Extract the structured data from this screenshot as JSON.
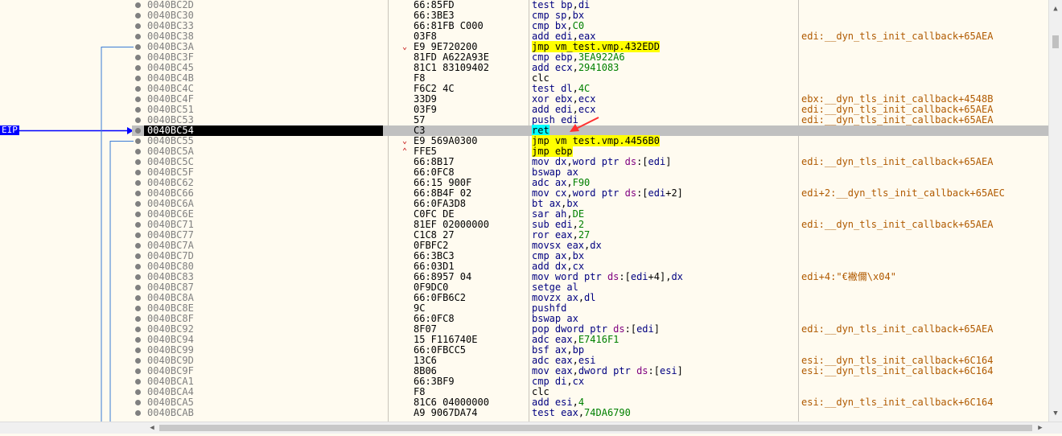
{
  "eip_label": "EIP",
  "rows": [
    {
      "addr": "0040BC2D",
      "bytes": "66:85FD",
      "dis": [
        [
          "test ",
          "kw-b"
        ],
        [
          "bp",
          "kw-b"
        ],
        [
          ",",
          ""
        ],
        [
          "di",
          "kw-b"
        ]
      ],
      "cmt": ""
    },
    {
      "addr": "0040BC30",
      "bytes": "66:3BE3",
      "dis": [
        [
          "cmp ",
          "kw-b"
        ],
        [
          "sp",
          "kw-b"
        ],
        [
          ",",
          ""
        ],
        [
          "bx",
          "kw-b"
        ]
      ],
      "cmt": ""
    },
    {
      "addr": "0040BC33",
      "bytes": "66:81FB C000",
      "dis": [
        [
          "cmp ",
          "kw-b"
        ],
        [
          "bx",
          "kw-b"
        ],
        [
          ",",
          ""
        ],
        [
          "C0",
          "num"
        ]
      ],
      "cmt": ""
    },
    {
      "addr": "0040BC38",
      "bytes": "03F8",
      "dis": [
        [
          "add ",
          "kw-b"
        ],
        [
          "edi",
          "kw-b"
        ],
        [
          ",",
          ""
        ],
        [
          "eax",
          "kw-b"
        ]
      ],
      "cmt": "edi:__dyn_tls_init_callback+65AEA"
    },
    {
      "addr": "0040BC3A",
      "jm": "⌄",
      "bytes": "E9 9E720200",
      "dis": [
        [
          "jmp vm_test.vmp.432EDD",
          "hl-y"
        ]
      ],
      "cmt": ""
    },
    {
      "addr": "0040BC3F",
      "bytes": "81FD A622A93E",
      "dis": [
        [
          "cmp ",
          "kw-b"
        ],
        [
          "ebp",
          "kw-b"
        ],
        [
          ",",
          ""
        ],
        [
          "3EA922A6",
          "num"
        ]
      ],
      "cmt": ""
    },
    {
      "addr": "0040BC45",
      "bytes": "81C1 83109402",
      "dis": [
        [
          "add ",
          "kw-b"
        ],
        [
          "ecx",
          "kw-b"
        ],
        [
          ",",
          ""
        ],
        [
          "2941083",
          "num"
        ]
      ],
      "cmt": ""
    },
    {
      "addr": "0040BC4B",
      "bytes": "F8",
      "dis": [
        [
          "clc",
          ""
        ]
      ],
      "cmt": ""
    },
    {
      "addr": "0040BC4C",
      "bytes": "F6C2 4C",
      "dis": [
        [
          "test ",
          "kw-b"
        ],
        [
          "dl",
          "kw-b"
        ],
        [
          ",",
          ""
        ],
        [
          "4C",
          "num"
        ]
      ],
      "cmt": ""
    },
    {
      "addr": "0040BC4F",
      "bytes": "33D9",
      "dis": [
        [
          "xor ",
          "kw-b"
        ],
        [
          "ebx",
          "kw-b"
        ],
        [
          ",",
          ""
        ],
        [
          "ecx",
          "kw-b"
        ]
      ],
      "cmt": "ebx:__dyn_tls_init_callback+4548B"
    },
    {
      "addr": "0040BC51",
      "bytes": "03F9",
      "dis": [
        [
          "add ",
          "kw-b"
        ],
        [
          "edi",
          "kw-b"
        ],
        [
          ",",
          ""
        ],
        [
          "ecx",
          "kw-b"
        ]
      ],
      "cmt": "edi:__dyn_tls_init_callback+65AEA"
    },
    {
      "addr": "0040BC53",
      "bytes": "57",
      "dis": [
        [
          "push ",
          "kw-b"
        ],
        [
          "edi",
          "kw-b"
        ]
      ],
      "cmt": "edi:__dyn_tls_init_callback+65AEA"
    },
    {
      "addr": "0040BC54",
      "bytes": "C3",
      "dis": [
        [
          "ret",
          "hl-c"
        ]
      ],
      "cmt": "",
      "current": true
    },
    {
      "addr": "0040BC55",
      "jm": "⌄",
      "bytes": "E9 569A0300",
      "dis": [
        [
          "jmp vm_test.vmp.4456B0",
          "hl-y"
        ]
      ],
      "cmt": ""
    },
    {
      "addr": "0040BC5A",
      "jm": "⌃",
      "bytes": "FFE5",
      "dis": [
        [
          "jmp ebp",
          "hl-y"
        ]
      ],
      "cmt": ""
    },
    {
      "addr": "0040BC5C",
      "bytes": "66:8B17",
      "dis": [
        [
          "mov ",
          "kw-b"
        ],
        [
          "dx",
          "kw-b"
        ],
        [
          ",",
          ""
        ],
        [
          "word ptr ",
          "kw-b"
        ],
        [
          "ds",
          "seg"
        ],
        [
          ":[",
          ""
        ],
        [
          "edi",
          "kw-b"
        ],
        [
          "]",
          ""
        ]
      ],
      "cmt": "edi:__dyn_tls_init_callback+65AEA"
    },
    {
      "addr": "0040BC5F",
      "bytes": "66:0FC8",
      "dis": [
        [
          "bswap ",
          "kw-b"
        ],
        [
          "ax",
          "kw-b"
        ]
      ],
      "cmt": ""
    },
    {
      "addr": "0040BC62",
      "bytes": "66:15 900F",
      "dis": [
        [
          "adc ",
          "kw-b"
        ],
        [
          "ax",
          "kw-b"
        ],
        [
          ",",
          ""
        ],
        [
          "F90",
          "num"
        ]
      ],
      "cmt": ""
    },
    {
      "addr": "0040BC66",
      "bytes": "66:8B4F 02",
      "dis": [
        [
          "mov ",
          "kw-b"
        ],
        [
          "cx",
          "kw-b"
        ],
        [
          ",",
          ""
        ],
        [
          "word ptr ",
          "kw-b"
        ],
        [
          "ds",
          "seg"
        ],
        [
          ":[",
          ""
        ],
        [
          "edi",
          "kw-b"
        ],
        [
          "+2]",
          ""
        ]
      ],
      "cmt": "edi+2:__dyn_tls_init_callback+65AEC"
    },
    {
      "addr": "0040BC6A",
      "bytes": "66:0FA3D8",
      "dis": [
        [
          "bt ",
          "kw-b"
        ],
        [
          "ax",
          "kw-b"
        ],
        [
          ",",
          ""
        ],
        [
          "bx",
          "kw-b"
        ]
      ],
      "cmt": ""
    },
    {
      "addr": "0040BC6E",
      "bytes": "C0FC DE",
      "dis": [
        [
          "sar ",
          "kw-b"
        ],
        [
          "ah",
          "kw-b"
        ],
        [
          ",",
          ""
        ],
        [
          "DE",
          "num"
        ]
      ],
      "cmt": ""
    },
    {
      "addr": "0040BC71",
      "bytes": "81EF 02000000",
      "dis": [
        [
          "sub ",
          "kw-b"
        ],
        [
          "edi",
          "kw-b"
        ],
        [
          ",",
          ""
        ],
        [
          "2",
          "num"
        ]
      ],
      "cmt": "edi:__dyn_tls_init_callback+65AEA"
    },
    {
      "addr": "0040BC77",
      "bytes": "C1C8 27",
      "dis": [
        [
          "ror ",
          "kw-b"
        ],
        [
          "eax",
          "kw-b"
        ],
        [
          ",",
          ""
        ],
        [
          "27",
          "num"
        ]
      ],
      "cmt": ""
    },
    {
      "addr": "0040BC7A",
      "bytes": "0FBFC2",
      "dis": [
        [
          "movsx ",
          "kw-b"
        ],
        [
          "eax",
          "kw-b"
        ],
        [
          ",",
          ""
        ],
        [
          "dx",
          "kw-b"
        ]
      ],
      "cmt": ""
    },
    {
      "addr": "0040BC7D",
      "bytes": "66:3BC3",
      "dis": [
        [
          "cmp ",
          "kw-b"
        ],
        [
          "ax",
          "kw-b"
        ],
        [
          ",",
          ""
        ],
        [
          "bx",
          "kw-b"
        ]
      ],
      "cmt": ""
    },
    {
      "addr": "0040BC80",
      "bytes": "66:03D1",
      "dis": [
        [
          "add ",
          "kw-b"
        ],
        [
          "dx",
          "kw-b"
        ],
        [
          ",",
          ""
        ],
        [
          "cx",
          "kw-b"
        ]
      ],
      "cmt": ""
    },
    {
      "addr": "0040BC83",
      "bytes": "66:8957 04",
      "dis": [
        [
          "mov ",
          "kw-b"
        ],
        [
          "word ptr ",
          "kw-b"
        ],
        [
          "ds",
          "seg"
        ],
        [
          ":[",
          ""
        ],
        [
          "edi",
          "kw-b"
        ],
        [
          "+4],",
          ""
        ],
        [
          "dx",
          "kw-b"
        ]
      ],
      "cmt": "edi+4:\"€襒儞\\x04\""
    },
    {
      "addr": "0040BC87",
      "bytes": "0F9DC0",
      "dis": [
        [
          "setge ",
          "kw-b"
        ],
        [
          "al",
          "kw-b"
        ]
      ],
      "cmt": ""
    },
    {
      "addr": "0040BC8A",
      "bytes": "66:0FB6C2",
      "dis": [
        [
          "movzx ",
          "kw-b"
        ],
        [
          "ax",
          "kw-b"
        ],
        [
          ",",
          ""
        ],
        [
          "dl",
          "kw-b"
        ]
      ],
      "cmt": ""
    },
    {
      "addr": "0040BC8E",
      "bytes": "9C",
      "dis": [
        [
          "pushfd",
          "kw-b"
        ]
      ],
      "cmt": ""
    },
    {
      "addr": "0040BC8F",
      "bytes": "66:0FC8",
      "dis": [
        [
          "bswap ",
          "kw-b"
        ],
        [
          "ax",
          "kw-b"
        ]
      ],
      "cmt": ""
    },
    {
      "addr": "0040BC92",
      "bytes": "8F07",
      "dis": [
        [
          "pop ",
          "kw-b"
        ],
        [
          "dword ptr ",
          "kw-b"
        ],
        [
          "ds",
          "seg"
        ],
        [
          ":[",
          ""
        ],
        [
          "edi",
          "kw-b"
        ],
        [
          "]",
          ""
        ]
      ],
      "cmt": "edi:__dyn_tls_init_callback+65AEA"
    },
    {
      "addr": "0040BC94",
      "bytes": "15 F116740E",
      "dis": [
        [
          "adc ",
          "kw-b"
        ],
        [
          "eax",
          "kw-b"
        ],
        [
          ",",
          ""
        ],
        [
          "E7416F1",
          "num"
        ]
      ],
      "cmt": ""
    },
    {
      "addr": "0040BC99",
      "bytes": "66:0FBCC5",
      "dis": [
        [
          "bsf ",
          "kw-b"
        ],
        [
          "ax",
          "kw-b"
        ],
        [
          ",",
          ""
        ],
        [
          "bp",
          "kw-b"
        ]
      ],
      "cmt": ""
    },
    {
      "addr": "0040BC9D",
      "bytes": "13C6",
      "dis": [
        [
          "adc ",
          "kw-b"
        ],
        [
          "eax",
          "kw-b"
        ],
        [
          ",",
          ""
        ],
        [
          "esi",
          "kw-b"
        ]
      ],
      "cmt": "esi:__dyn_tls_init_callback+6C164"
    },
    {
      "addr": "0040BC9F",
      "bytes": "8B06",
      "dis": [
        [
          "mov ",
          "kw-b"
        ],
        [
          "eax",
          "kw-b"
        ],
        [
          ",",
          ""
        ],
        [
          "dword ptr ",
          "kw-b"
        ],
        [
          "ds",
          "seg"
        ],
        [
          ":[",
          ""
        ],
        [
          "esi",
          "kw-b"
        ],
        [
          "]",
          ""
        ]
      ],
      "cmt": "esi:__dyn_tls_init_callback+6C164"
    },
    {
      "addr": "0040BCA1",
      "bytes": "66:3BF9",
      "dis": [
        [
          "cmp ",
          "kw-b"
        ],
        [
          "di",
          "kw-b"
        ],
        [
          ",",
          ""
        ],
        [
          "cx",
          "kw-b"
        ]
      ],
      "cmt": ""
    },
    {
      "addr": "0040BCA4",
      "bytes": "F8",
      "dis": [
        [
          "clc",
          ""
        ]
      ],
      "cmt": ""
    },
    {
      "addr": "0040BCA5",
      "bytes": "81C6 04000000",
      "dis": [
        [
          "add ",
          "kw-b"
        ],
        [
          "esi",
          "kw-b"
        ],
        [
          ",",
          ""
        ],
        [
          "4",
          "num"
        ]
      ],
      "cmt": "esi:__dyn_tls_init_callback+6C164"
    },
    {
      "addr": "0040BCAB",
      "bytes": "A9 9067DA74",
      "dis": [
        [
          "test ",
          "kw-b"
        ],
        [
          "eax",
          "kw-b"
        ],
        [
          ",",
          ""
        ],
        [
          "74DA6790",
          "num"
        ]
      ],
      "cmt": ""
    }
  ]
}
